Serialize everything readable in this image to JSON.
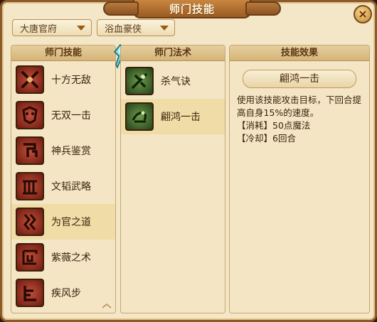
{
  "window": {
    "title": "师门技能",
    "close_label": "×"
  },
  "filters": {
    "school": "大唐官府",
    "category": "浴血豪侠"
  },
  "school_panel": {
    "header": "师门技能",
    "items": [
      {
        "label": "十方无敌",
        "icon": "crossed-swords-icon"
      },
      {
        "label": "无双一击",
        "icon": "demon-mask-icon"
      },
      {
        "label": "神兵鉴赏",
        "icon": "weapon-rack-icon"
      },
      {
        "label": "文韬武略",
        "icon": "gate-icon"
      },
      {
        "label": "为官之道",
        "icon": "official-seal-icon"
      },
      {
        "label": "紫薇之术",
        "icon": "rune-icon"
      },
      {
        "label": "疾风步",
        "icon": "step-icon"
      }
    ],
    "selected_index": 4
  },
  "spell_panel": {
    "header": "师门法术",
    "items": [
      {
        "label": "杀气诀",
        "icon": "sword-aura-icon"
      },
      {
        "label": "翩鸿一击",
        "icon": "swan-strike-icon"
      }
    ],
    "selected_index": 1
  },
  "effect_panel": {
    "header": "技能效果",
    "skill_name": "翩鸿一击",
    "description": "使用该技能攻击目标，下回合提高自身15%的速度。",
    "cost": "【消耗】50点魔法",
    "cooldown": "【冷却】6回合"
  },
  "colors": {
    "frame": "#8a5a2a",
    "panel_bg": "#f4e6c4",
    "selected_row": "#f0dca6",
    "text": "#3a2410"
  }
}
